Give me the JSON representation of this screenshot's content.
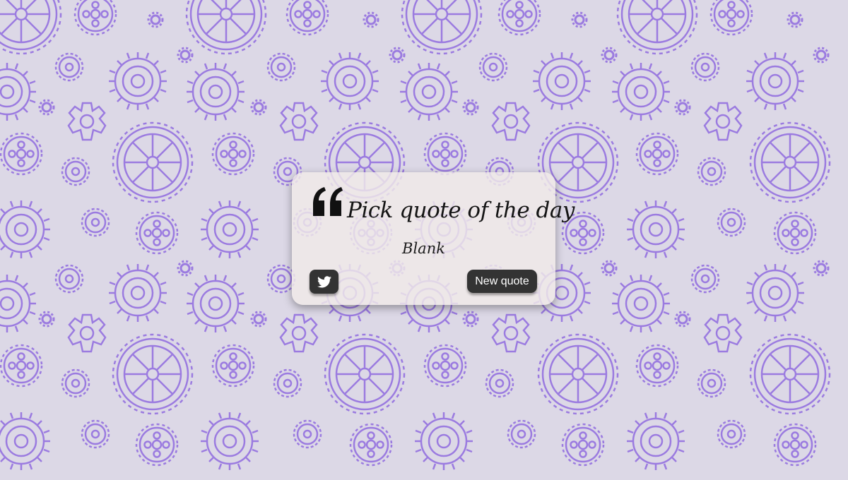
{
  "background": {
    "color": "#dcd8e6",
    "pattern_color": "#9b7be0",
    "pattern_icon": "gear-icon"
  },
  "quote": {
    "icon": "quote-left-icon",
    "text": "Pick quote of the day",
    "author": "Blank"
  },
  "buttons": {
    "tweet_icon": "twitter-icon",
    "new_quote_label": "New quote",
    "color": "#333333"
  }
}
